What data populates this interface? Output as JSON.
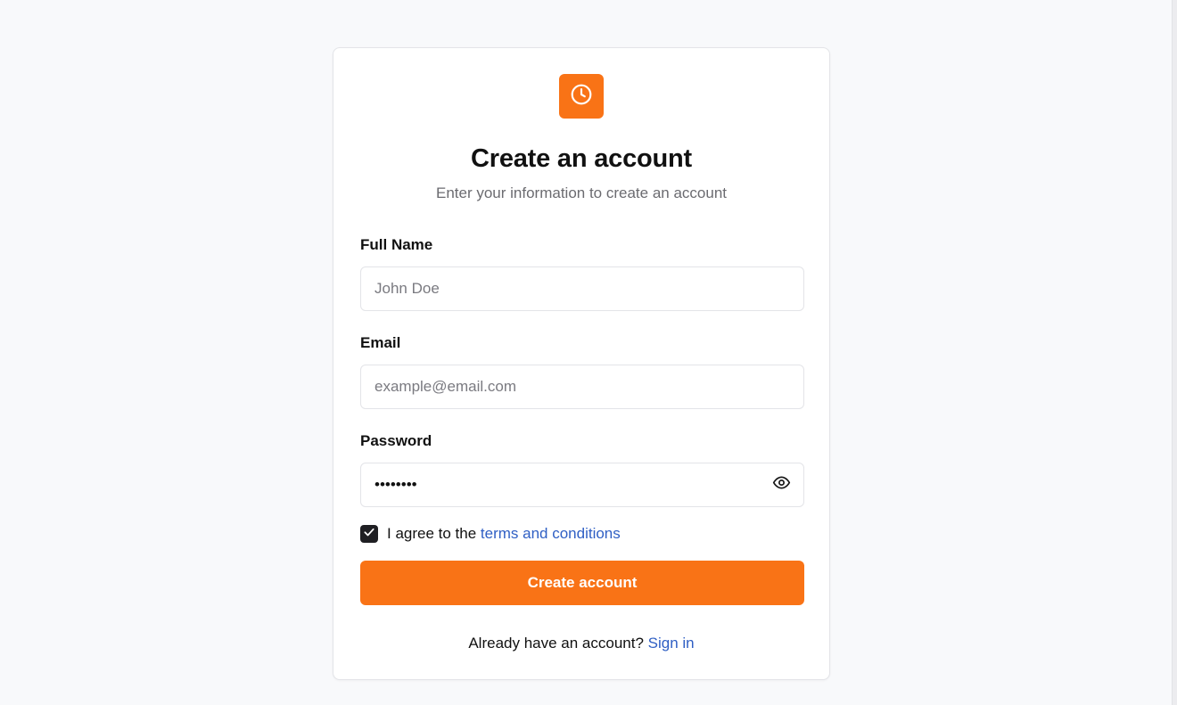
{
  "header": {
    "title": "Create an account",
    "subtitle": "Enter your information to create an account"
  },
  "form": {
    "full_name": {
      "label": "Full Name",
      "placeholder": "John Doe",
      "value": ""
    },
    "email": {
      "label": "Email",
      "placeholder": "example@email.com",
      "value": ""
    },
    "password": {
      "label": "Password",
      "value": "••••••••"
    },
    "terms": {
      "prefix": "I agree to the ",
      "link_label": "terms and conditions",
      "checked": true
    },
    "submit_label": "Create account"
  },
  "footer": {
    "prompt": "Already have an account? ",
    "link_label": "Sign in"
  },
  "icons": {
    "logo": "clock-icon",
    "password_toggle": "eye-icon",
    "checkbox": "check-icon"
  },
  "colors": {
    "accent": "#f97316",
    "link": "#2f5fc4",
    "checkbox": "#1f1f23",
    "background": "#f8f9fb"
  }
}
